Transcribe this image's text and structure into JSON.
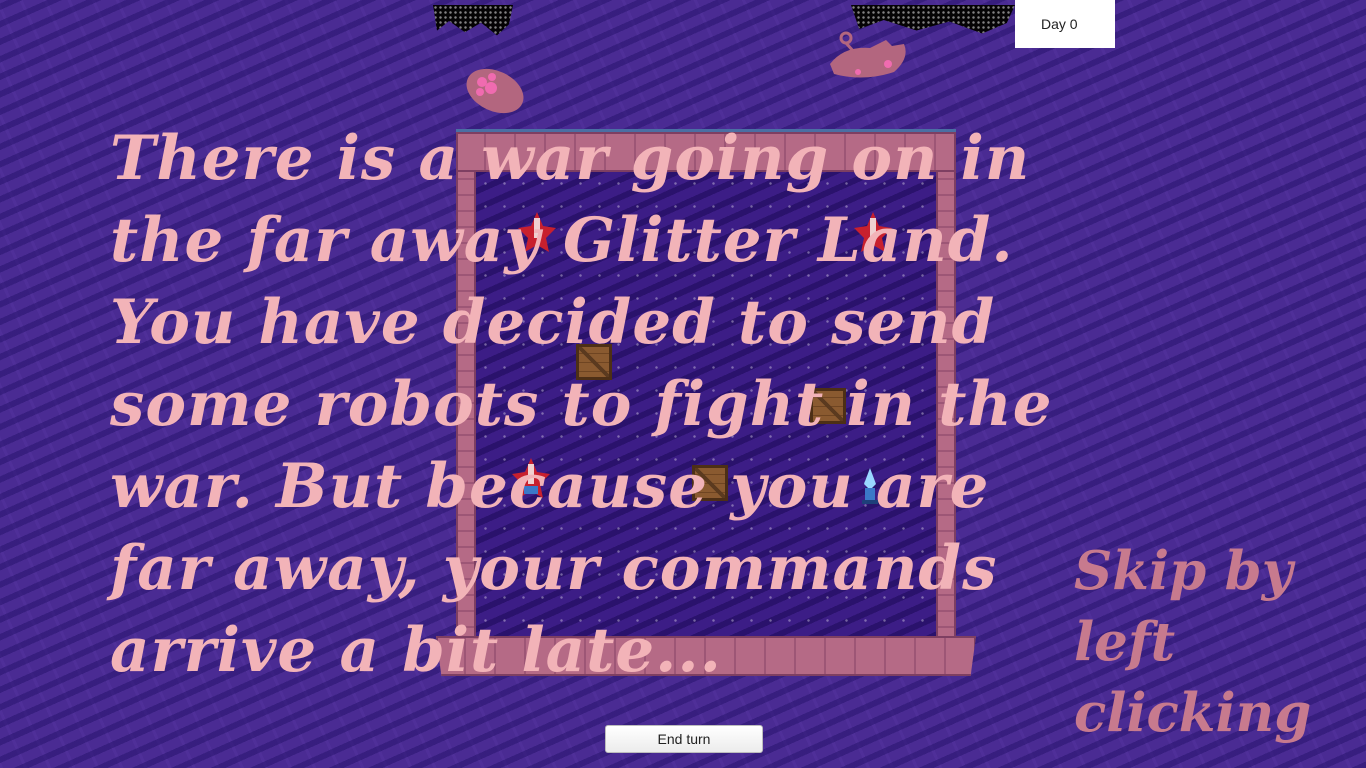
{
  "hud": {
    "day_label": "Day 0",
    "end_turn_label": "End turn"
  },
  "intro": {
    "story_text": "There is a war going on in the far away Glitter Land. You have decided to send some robots to fight in the war. But because you are far away, your commands arrive a bit late...",
    "skip_hint": "Skip by left clicking"
  },
  "sprites": {
    "red_robot_icon": "robot-icon",
    "blue_robot_icon": "robot-icon",
    "crate_icon": "crate-icon",
    "creature_icon": "paw-creature-icon"
  },
  "colors": {
    "background": "#4a2b93",
    "story_text": "#f2b3b8",
    "skip_text": "#c77a8e",
    "wall": "#b56a86"
  }
}
